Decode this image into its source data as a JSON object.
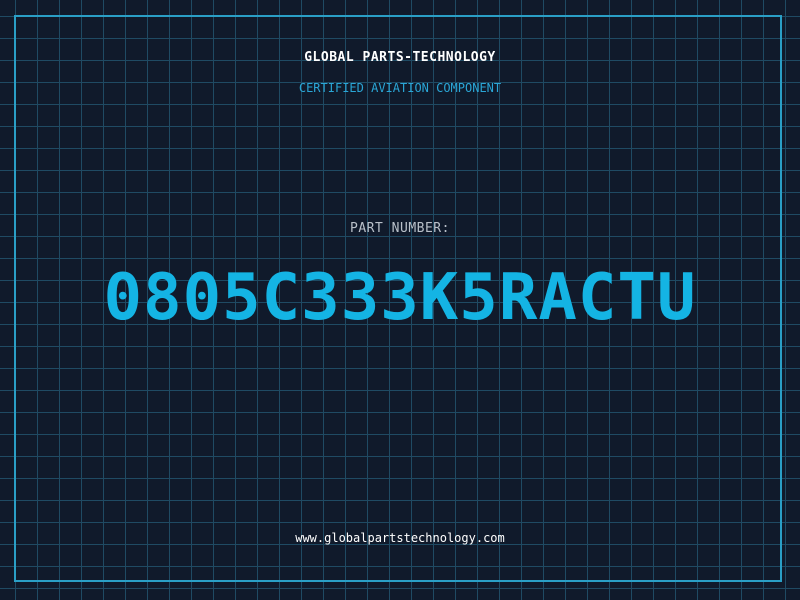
{
  "header": {
    "company": "GLOBAL PARTS-TECHNOLOGY",
    "tagline": "CERTIFIED AVIATION COMPONENT"
  },
  "part": {
    "label": "PART NUMBER:",
    "number": "0805C333K5RACTU"
  },
  "footer": {
    "website": "www.globalpartstechnology.com"
  },
  "colors": {
    "background": "#101a2b",
    "grid": "#1f4a63",
    "border": "#2a9fc6",
    "accent": "#14b4e4",
    "text_primary": "#ffffff",
    "text_secondary": "#b9c0c9"
  }
}
